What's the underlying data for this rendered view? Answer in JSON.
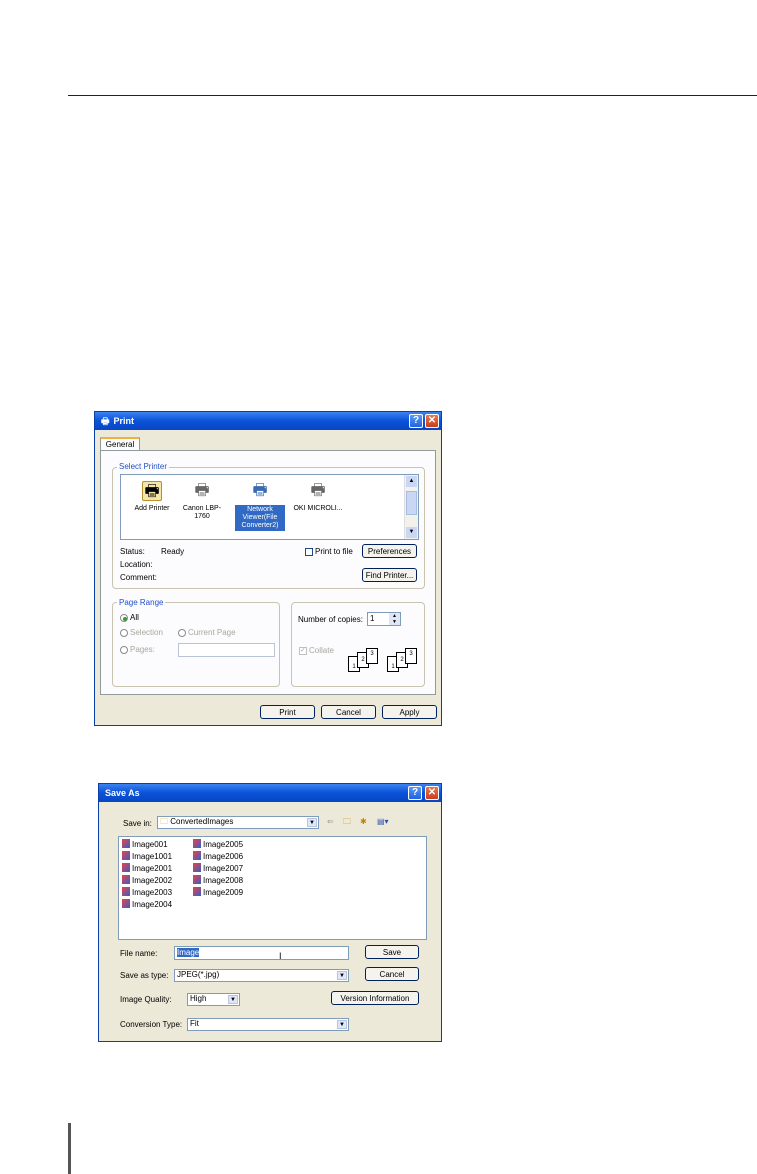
{
  "print_dialog": {
    "title": "Print",
    "help": "?",
    "close": "✕",
    "tab": "General",
    "select_printer_label": "Select Printer",
    "printers": [
      {
        "label": "Add Printer",
        "icon": "add-printer-icon"
      },
      {
        "label": "Canon LBP-1760",
        "icon": "printer-icon"
      },
      {
        "label": "Network Viewer(File Converter2)",
        "icon": "network-printer-icon",
        "selected": true
      },
      {
        "label": "OKI MICROLI...",
        "icon": "printer-icon"
      }
    ],
    "status_label": "Status:",
    "status_value": "Ready",
    "location_label": "Location:",
    "comment_label": "Comment:",
    "print_to_file": "Print to file",
    "preferences": "Preferences",
    "find_printer": "Find Printer...",
    "page_range_label": "Page Range",
    "all": "All",
    "selection": "Selection",
    "current_page": "Current Page",
    "pages": "Pages:",
    "copies_label": "Number of copies:",
    "copies_value": "1",
    "collate": "Collate",
    "print_btn": "Print",
    "cancel_btn": "Cancel",
    "apply_btn": "Apply"
  },
  "save_dialog": {
    "title": "Save As",
    "help": "?",
    "close": "✕",
    "save_in_label": "Save in:",
    "save_in_value": "ConvertedImages",
    "files_col1": [
      "Image001",
      "Image1001",
      "Image2001",
      "Image2002",
      "Image2003",
      "Image2004"
    ],
    "files_col2": [
      "Image2005",
      "Image2006",
      "Image2007",
      "Image2008",
      "Image2009"
    ],
    "file_name_label": "File name:",
    "file_name_value": "Image",
    "save_type_label": "Save as type:",
    "save_type_value": "JPEG(*.jpg)",
    "quality_label": "Image Quality:",
    "quality_value": "High",
    "conversion_label": "Conversion Type:",
    "conversion_value": "Fit",
    "save_btn": "Save",
    "cancel_btn": "Cancel",
    "version_btn": "Version Information"
  }
}
